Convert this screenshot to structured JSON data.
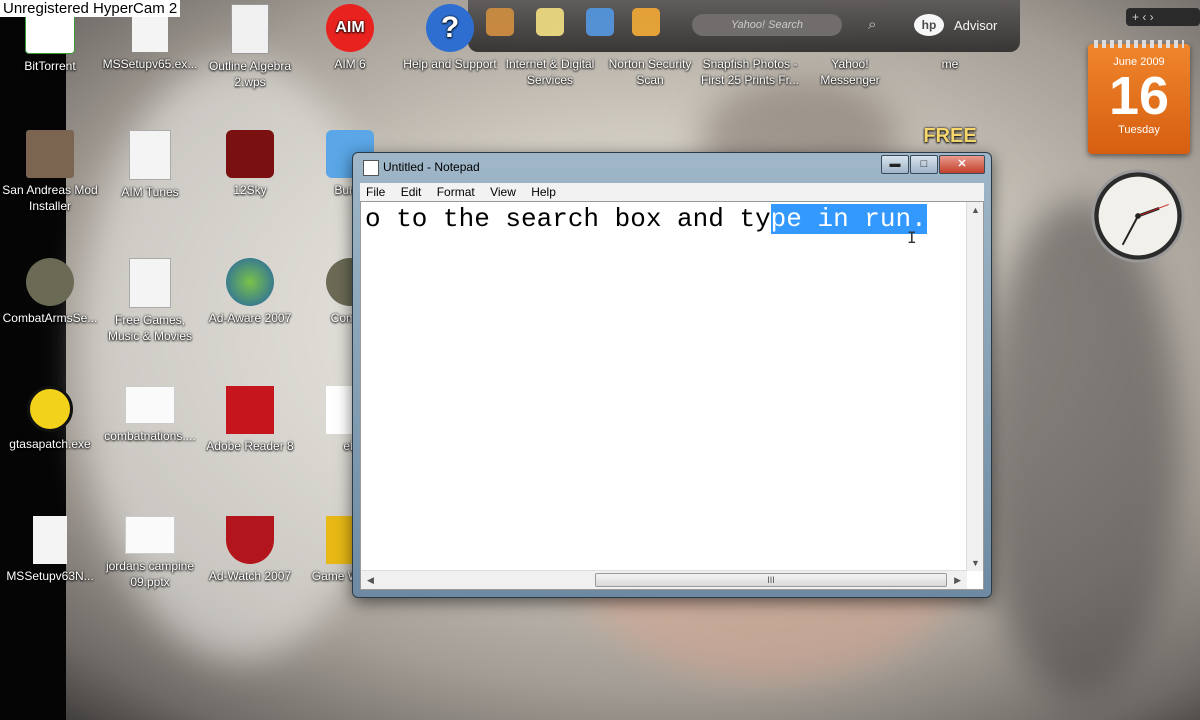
{
  "watermark": "Unregistered HyperCam 2",
  "desktop_icons": [
    {
      "label": "BitTorrent"
    },
    {
      "label": "MSSetupv65.ex..."
    },
    {
      "label": "Outline Algebra 2.wps"
    },
    {
      "label": "AIM 6"
    },
    {
      "label": "Help and Support"
    },
    {
      "label": "Internet & Digital Services"
    },
    {
      "label": "Norton Security Scan"
    },
    {
      "label": "Snapfish Photos - First 25 Prints Fr..."
    },
    {
      "label": "Yahoo! Messenger"
    },
    {
      "label": "me"
    },
    {
      "label": "San Andreas Mod Installer"
    },
    {
      "label": "AIM Tunes"
    },
    {
      "label": "12Sky"
    },
    {
      "label": "Bump"
    },
    {
      "label": "CombatArmsSe..."
    },
    {
      "label": "Free Games, Music & Movies"
    },
    {
      "label": "Ad-Aware 2007"
    },
    {
      "label": "Comba"
    },
    {
      "label": "gtasapatch.exe"
    },
    {
      "label": "combatnations...."
    },
    {
      "label": "Adobe Reader 8"
    },
    {
      "label": "eb"
    },
    {
      "label": "MSSetupv63N..."
    },
    {
      "label": "jordans campine 09.pptx"
    },
    {
      "label": "Ad-Watch 2007"
    },
    {
      "label": "Game Word C"
    },
    {
      "label": "FREE"
    }
  ],
  "gadget_bar": {
    "search_placeholder": "Yahoo! Search",
    "hp_logo": "hp",
    "hp_label": "Advisor"
  },
  "sidebar_controls": "+  ‹  ›",
  "calendar": {
    "month": "June 2009",
    "day": "16",
    "weekday": "Tuesday"
  },
  "notepad": {
    "title": "Untitled - Notepad",
    "menu": [
      "File",
      "Edit",
      "Format",
      "View",
      "Help"
    ],
    "text_plain": "o to the search box and ty",
    "text_selected": "pe in run.",
    "hscroll_grip": "III",
    "buttons": {
      "minimize": "▬",
      "maximize": "□",
      "close": "✕"
    }
  },
  "colors": {
    "selection": "#3399ff",
    "calendar": "#e8731f",
    "aim": "#e8231f"
  }
}
